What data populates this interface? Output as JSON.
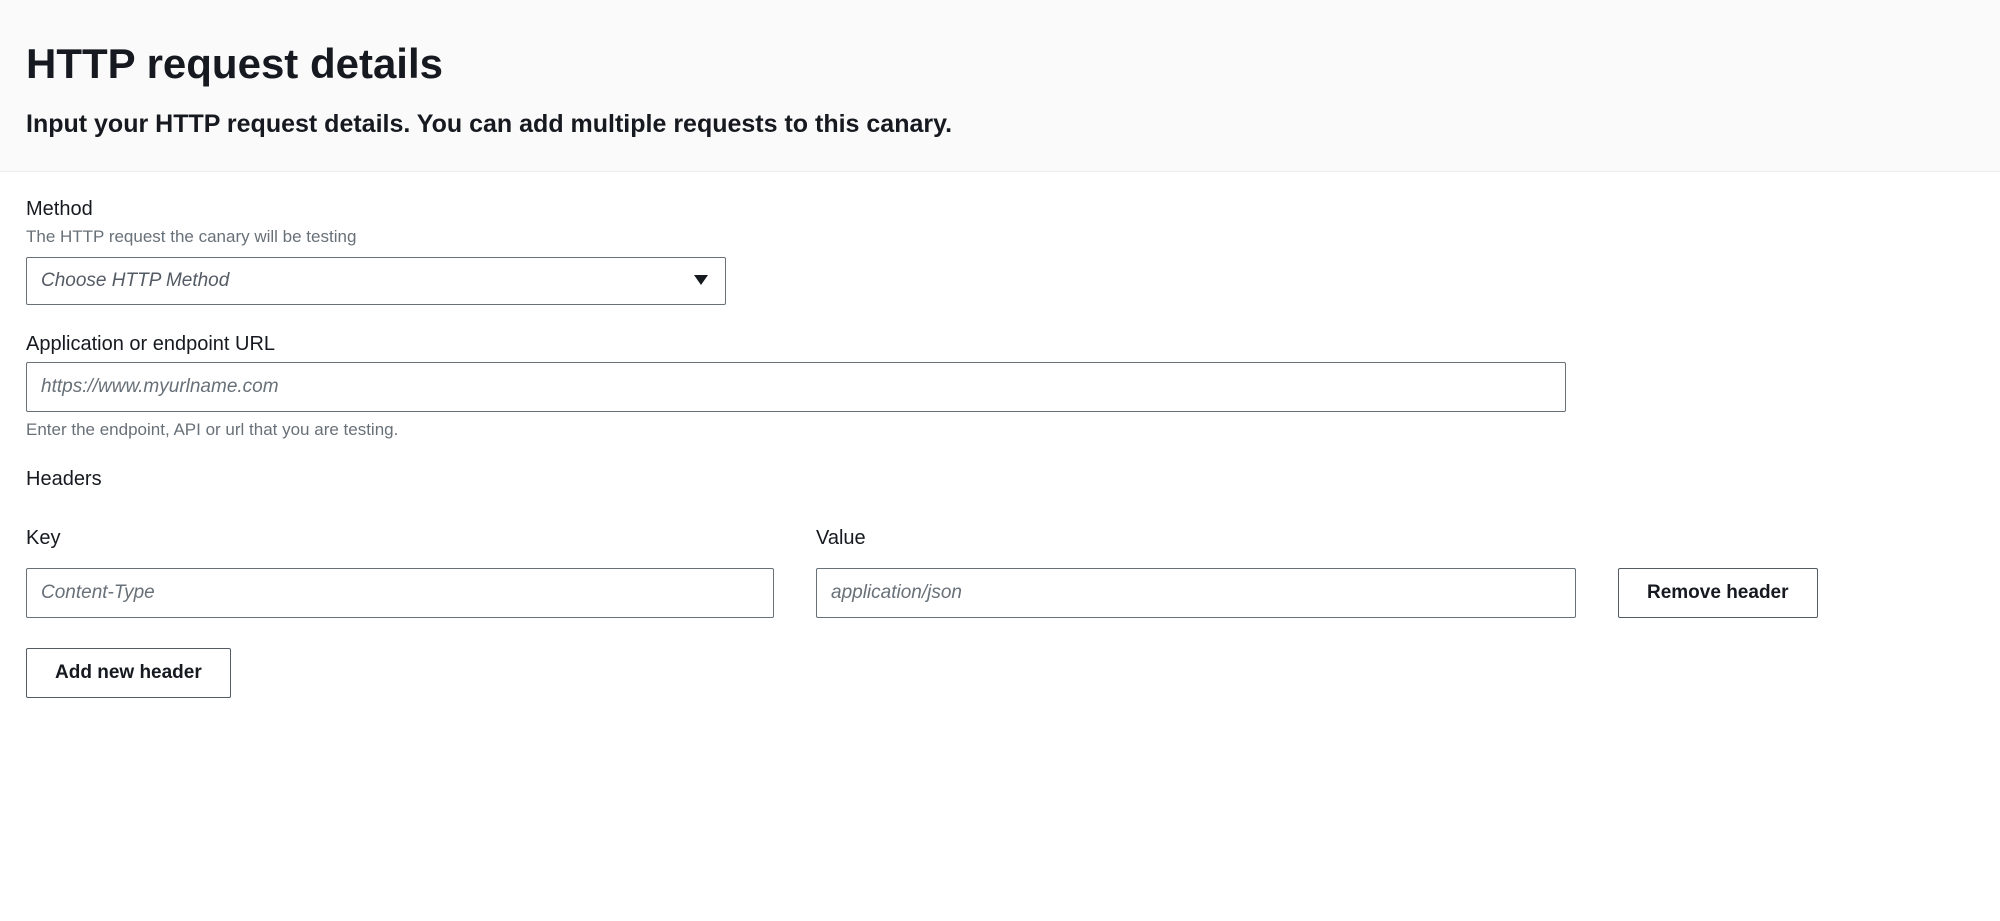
{
  "header": {
    "title": "HTTP request details",
    "subtitle": "Input your HTTP request details. You can add multiple requests to this canary."
  },
  "method": {
    "label": "Method",
    "hint": "The HTTP request the canary will be testing",
    "placeholder": "Choose HTTP Method"
  },
  "url": {
    "label": "Application or endpoint URL",
    "placeholder": "https://www.myurlname.com",
    "hint_below": "Enter the endpoint, API or url that you are testing."
  },
  "headers": {
    "section_label": "Headers",
    "key_label": "Key",
    "value_label": "Value",
    "rows": [
      {
        "key_placeholder": "Content-Type",
        "value_placeholder": "application/json"
      }
    ],
    "remove_label": "Remove header",
    "add_label": "Add new header"
  }
}
